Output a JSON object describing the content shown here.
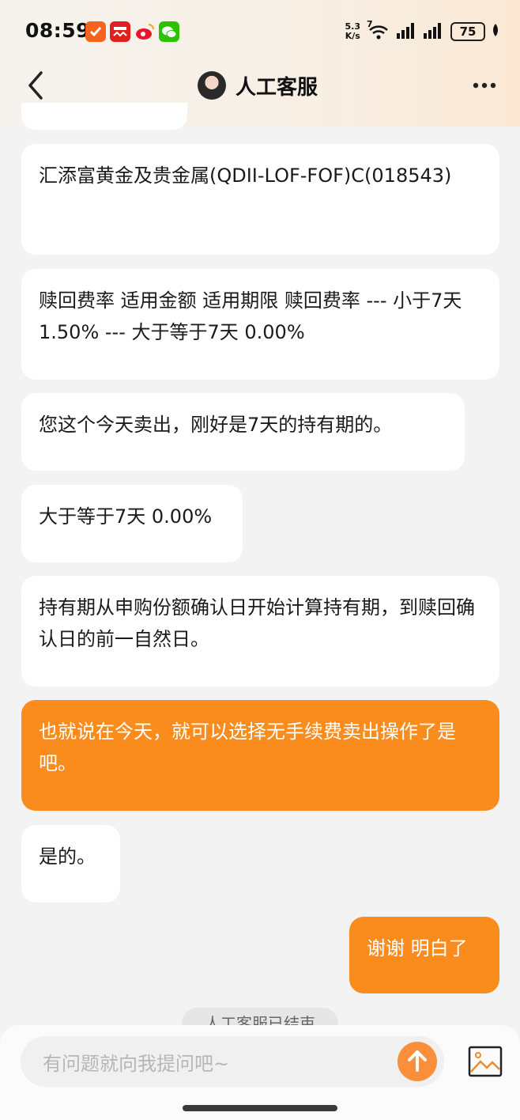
{
  "status_bar": {
    "time": "08:59",
    "net_speed_value": "5.3",
    "net_speed_unit": "K/s",
    "signal_label": "7",
    "battery": "75",
    "app_icons": [
      "check-app-icon",
      "news-app-icon",
      "weibo-icon",
      "wechat-icon"
    ]
  },
  "header": {
    "title": "人工客服",
    "back_icon": "chevron-left-icon",
    "more_icon": "more-dots-icon"
  },
  "messages": [
    {
      "sender": "agent",
      "text": "汇添富黄金及贵金属(QDII-LOF-FOF)C(018543)"
    },
    {
      "sender": "agent",
      "text": "赎回费率 适用金额 适用期限 赎回费率 --- 小于7天 1.50% --- 大于等于7天 0.00%"
    },
    {
      "sender": "agent",
      "text": "您这个今天卖出，刚好是7天的持有期的。"
    },
    {
      "sender": "agent",
      "text": "大于等于7天 0.00%"
    },
    {
      "sender": "agent",
      "text": "持有期从申购份额确认日开始计算持有期，到赎回确认日的前一自然日。"
    },
    {
      "sender": "user",
      "text": "也就说在今天，就可以选择无手续费卖出操作了是吧。"
    },
    {
      "sender": "agent",
      "text": "是的。"
    },
    {
      "sender": "user",
      "text": "谢谢 明白了"
    }
  ],
  "system_notice": "人工客服已结束",
  "input": {
    "placeholder": "有问题就向我提问吧~"
  },
  "colors": {
    "accent": "#fa8c1e",
    "bubble_agent": "#ffffff",
    "background": "#f3f3f3"
  }
}
